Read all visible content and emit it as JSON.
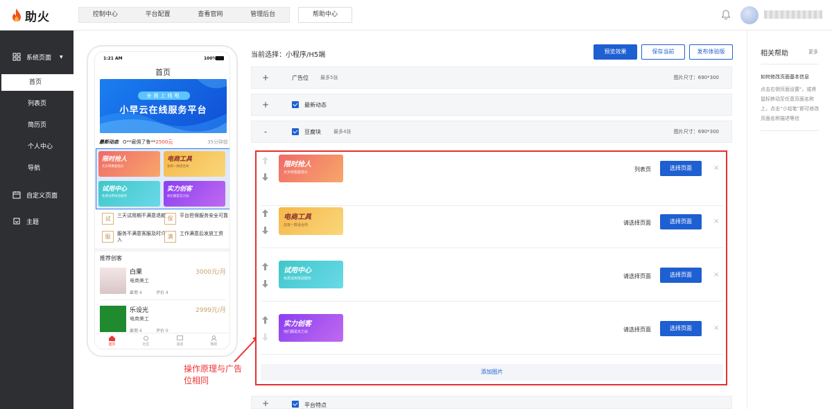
{
  "brand": {
    "name": "助火"
  },
  "topnav": {
    "items": [
      "控制中心",
      "平台配置",
      "查看官网",
      "管理后台"
    ],
    "help": "帮助中心"
  },
  "sidebar": {
    "system": "系统页面",
    "subitems": [
      "首页",
      "列表页",
      "简历页",
      "个人中心",
      "导航"
    ],
    "custom": "自定义页面",
    "theme": "主题"
  },
  "phone": {
    "time": "1:21 AM",
    "battery": "100%",
    "title": "首页",
    "banner_pill": "全面上线啦",
    "banner_title": "小早云在线服务平台",
    "news_label": "最新动态",
    "news_text": "O**雇佣了鲁**",
    "news_price": "2500元",
    "news_time": "35分钟前",
    "grid": [
      {
        "title": "限时抢人",
        "sub": "天天特惠超低价"
      },
      {
        "title": "电商工具",
        "sub": "总有一款适合你"
      },
      {
        "title": "试用中心",
        "sub": "免费试用体验服务"
      },
      {
        "title": "实力创客",
        "sub": "他们都是实力派"
      }
    ],
    "features": [
      {
        "icon": "试",
        "text": "三天试用期不满意退款"
      },
      {
        "icon": "保",
        "text": "平台担保服务安全可靠"
      },
      {
        "icon": "服",
        "text": "服务不满意客服及时介入"
      },
      {
        "icon": "满",
        "text": "工作满意后发放工资"
      }
    ],
    "rec_title": "推荐创客",
    "recs": [
      {
        "name": "白果",
        "price": "3000元/月",
        "job": "电商美工",
        "hire": "雇佣 4",
        "review": "评价 4"
      },
      {
        "name": "乐设光",
        "price": "2999元/月",
        "job": "电商美工",
        "hire": "雇佣 4",
        "review": "评价 0"
      }
    ],
    "tabs": [
      "首页",
      "社区",
      "消息",
      "我的"
    ]
  },
  "annotation": "操作原理与广告位相同",
  "main": {
    "current": "当前选择：小程序/H5端",
    "buttons": {
      "preview": "预览效果",
      "save": "保存当前",
      "publish": "发布体验版"
    },
    "sections": [
      {
        "toggle": "+",
        "label": "广告位",
        "limit": "最多5张",
        "size": "图片尺寸：690*300"
      },
      {
        "toggle": "+",
        "label": "最新动态"
      },
      {
        "toggle": "-",
        "label": "豆腐块",
        "limit": "最多4张",
        "size": "图片尺寸：690*300"
      },
      {
        "toggle": "+",
        "label": "平台特点"
      }
    ],
    "items": [
      {
        "title": "限时抢人",
        "sub": "天天特惠超低价",
        "page": "列表页",
        "btn": "选择页面",
        "close": "×"
      },
      {
        "title": "电商工具",
        "sub": "总有一款适合你",
        "page": "请选择页面",
        "btn": "选择页面",
        "close": "×"
      },
      {
        "title": "试用中心",
        "sub": "免费试用体验服务",
        "page": "请选择页面",
        "btn": "选择页面",
        "close": "×"
      },
      {
        "title": "实力创客",
        "sub": "他们都是实力派",
        "page": "请选择页面",
        "btn": "选择页面",
        "close": "×"
      }
    ],
    "add_image": "添加图片"
  },
  "help": {
    "title": "相关帮助",
    "more": "更多",
    "subtitle": "如何修改页面基本信息",
    "desc": "点击右侧页面设置\"，或将鼠标移动至任意页面名称上，点击“小铅笔”即可修改页面名称描述等信"
  },
  "colors": {
    "accent": "#1e5fd2",
    "highlight": "#e23030",
    "sidebar": "#2d2f33",
    "price": "#c7a16a"
  }
}
